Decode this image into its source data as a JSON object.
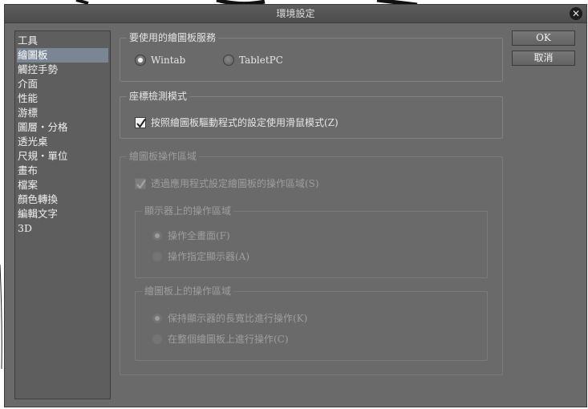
{
  "window": {
    "title": "環境設定"
  },
  "sidebar": {
    "items": [
      {
        "label": "工具"
      },
      {
        "label": "繪圖板"
      },
      {
        "label": "觸控手勢"
      },
      {
        "label": "介面"
      },
      {
        "label": "性能"
      },
      {
        "label": "游標"
      },
      {
        "label": "圖層・分格"
      },
      {
        "label": "透光桌"
      },
      {
        "label": "尺規・單位"
      },
      {
        "label": "畫布"
      },
      {
        "label": "檔案"
      },
      {
        "label": "顏色轉換"
      },
      {
        "label": "編輯文字"
      },
      {
        "label": "3D"
      }
    ],
    "selected_index": 1
  },
  "buttons": {
    "ok": "OK",
    "cancel": "取消"
  },
  "tablet_service": {
    "title": "要使用的繪圖板服務",
    "options": [
      {
        "label": "Wintab",
        "selected": true
      },
      {
        "label": "TabletPC",
        "selected": false
      }
    ]
  },
  "coordinate_mode": {
    "title": "座標檢測模式",
    "checkbox_label": "按照繪圖板驅動程式的設定使用滑鼠模式(Z)",
    "checked": true
  },
  "tablet_area": {
    "title": "繪圖板操作區域",
    "checkbox_label": "透過應用程式設定繪圖板的操作區域(S)",
    "checked": true,
    "enabled": false,
    "display_area": {
      "title": "顯示器上的操作區域",
      "options": [
        {
          "label": "操作全畫面(F)",
          "selected": true
        },
        {
          "label": "操作指定顯示器(A)",
          "selected": false
        }
      ]
    },
    "pad_area": {
      "title": "繪圖板上的操作區域",
      "options": [
        {
          "label": "保持顯示器的長寬比進行操作(K)",
          "selected": true
        },
        {
          "label": "在整個繪圖板上進行操作(C)",
          "selected": false
        }
      ]
    }
  },
  "colors": {
    "dialog_bg": "#6a6a6a",
    "selection": "#7b8695"
  }
}
